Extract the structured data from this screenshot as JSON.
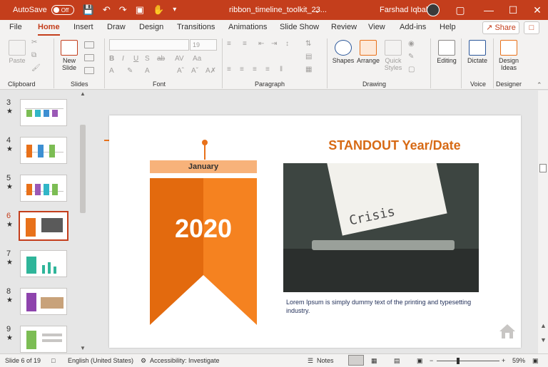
{
  "titlebar": {
    "autosave_label": "AutoSave",
    "autosave_state": "Off",
    "filename": "ribbon_timeline_toolkit_23...",
    "user_name": "Farshad Iqbal"
  },
  "tabs": [
    "File",
    "Home",
    "Insert",
    "Draw",
    "Design",
    "Transitions",
    "Animations",
    "Slide Show",
    "Review",
    "View",
    "Add-ins",
    "Help"
  ],
  "active_tab": "Home",
  "share_label": "Share",
  "ribbon": {
    "groups": [
      "Clipboard",
      "Slides",
      "Font",
      "Paragraph",
      "Drawing",
      "Voice",
      "Designer"
    ],
    "paste_label": "Paste",
    "new_slide_label": "New\nSlide",
    "font_size_value": "19",
    "shapes_label": "Shapes",
    "arrange_label": "Arrange",
    "quick_styles_label": "Quick\nStyles",
    "editing_label": "Editing",
    "dictate_label": "Dictate",
    "design_ideas_label": "Design\nIdeas"
  },
  "thumbnails": [
    {
      "num": "3",
      "active": false
    },
    {
      "num": "4",
      "active": false
    },
    {
      "num": "5",
      "active": false
    },
    {
      "num": "6",
      "active": true
    },
    {
      "num": "7",
      "active": false
    },
    {
      "num": "8",
      "active": false
    },
    {
      "num": "9",
      "active": false
    }
  ],
  "slide": {
    "banner_month": "January",
    "banner_year": "2020",
    "heading": "STANDOUT Year/Date",
    "photo_word": "Crisis",
    "caption": "Lorem Ipsum is simply dummy text of the printing and typesetting industry.",
    "colors": {
      "accent": "#e8711a",
      "accent_dark": "#e36a0e",
      "accent_light": "#f7b27a",
      "heading": "#d76a15"
    }
  },
  "statusbar": {
    "slide_info": "Slide 6 of 19",
    "language": "English (United States)",
    "accessibility": "Accessibility: Investigate",
    "notes_label": "Notes",
    "zoom": "59%"
  }
}
